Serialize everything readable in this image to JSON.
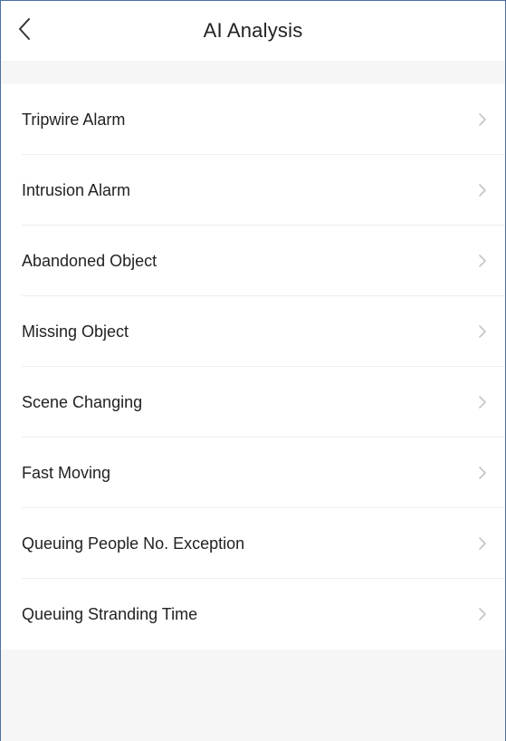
{
  "header": {
    "title": "AI Analysis",
    "back_icon": "chevron-left-icon"
  },
  "menu": {
    "items": [
      {
        "label": "Tripwire Alarm",
        "name": "menu-item-tripwire-alarm"
      },
      {
        "label": "Intrusion Alarm",
        "name": "menu-item-intrusion-alarm"
      },
      {
        "label": "Abandoned Object",
        "name": "menu-item-abandoned-object"
      },
      {
        "label": "Missing Object",
        "name": "menu-item-missing-object"
      },
      {
        "label": "Scene Changing",
        "name": "menu-item-scene-changing"
      },
      {
        "label": "Fast Moving",
        "name": "menu-item-fast-moving"
      },
      {
        "label": "Queuing People No. Exception",
        "name": "menu-item-queuing-people-no-exception"
      },
      {
        "label": "Queuing Stranding Time",
        "name": "menu-item-queuing-stranding-time"
      }
    ],
    "item_icon": "chevron-right-icon"
  },
  "colors": {
    "frame_border": "#4a6fa5",
    "background_gray": "#f6f6f6",
    "text": "#222222",
    "chevron": "#c4c4c4"
  }
}
